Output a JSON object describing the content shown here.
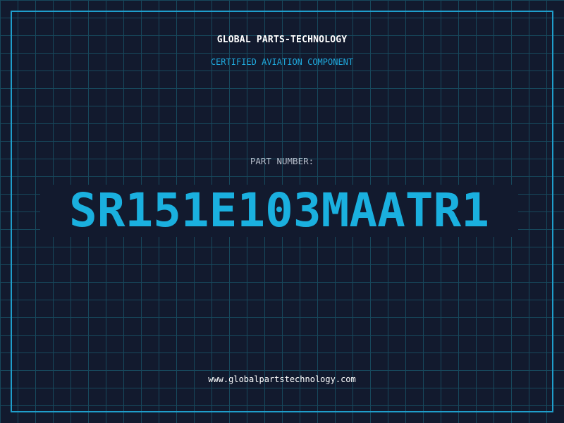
{
  "header": {
    "company": "GLOBAL PARTS-TECHNOLOGY",
    "tagline": "CERTIFIED AVIATION COMPONENT"
  },
  "part": {
    "label": "PART NUMBER:",
    "number": "SR151E103MAATR1"
  },
  "footer": {
    "website": "www.globalpartstechnology.com"
  },
  "colors": {
    "background": "#121a2e",
    "grid": "#17485c",
    "accent": "#1fa9dd",
    "text": "#ffffff",
    "muted": "#b9bfcc"
  }
}
